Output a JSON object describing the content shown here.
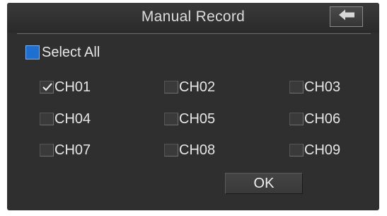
{
  "dialog": {
    "title": "Manual Record",
    "back_icon": "back-arrow-icon"
  },
  "select_all": {
    "label": "Select All",
    "checked": false
  },
  "channels": [
    {
      "label": "CH01",
      "checked": true
    },
    {
      "label": "CH02",
      "checked": false
    },
    {
      "label": "CH03",
      "checked": false
    },
    {
      "label": "CH04",
      "checked": false
    },
    {
      "label": "CH05",
      "checked": false
    },
    {
      "label": "CH06",
      "checked": false
    },
    {
      "label": "CH07",
      "checked": false
    },
    {
      "label": "CH08",
      "checked": false
    },
    {
      "label": "CH09",
      "checked": false
    }
  ],
  "ok_button": {
    "label": "OK"
  },
  "colors": {
    "panel_bg": "#2f2f2f",
    "select_all_box": "#1f6fd0",
    "text": "#e6e6e6"
  }
}
